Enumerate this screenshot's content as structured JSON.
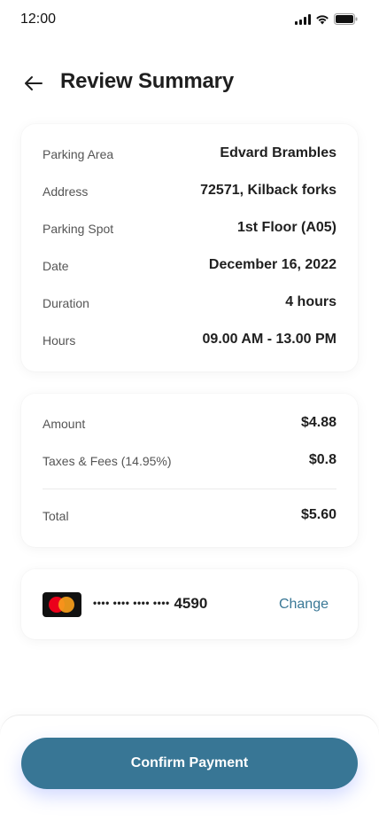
{
  "status_bar": {
    "time": "12:00"
  },
  "header": {
    "title": "Review Summary",
    "back_icon": "arrow-left-icon"
  },
  "details": [
    {
      "label": "Parking Area",
      "value": "Edvard Brambles"
    },
    {
      "label": "Address",
      "value": "72571, Kilback forks"
    },
    {
      "label": "Parking Spot",
      "value": "1st Floor (A05)"
    },
    {
      "label": "Date",
      "value": "December 16, 2022"
    },
    {
      "label": "Duration",
      "value": "4 hours"
    },
    {
      "label": "Hours",
      "value": "09.00 AM - 13.00 PM"
    }
  ],
  "amount": {
    "amount_label": "Amount",
    "amount_value": "$4.88",
    "taxes_label": "Taxes & Fees (14.95%)",
    "taxes_value": "$0.8",
    "total_label": "Total",
    "total_value": "$5.60"
  },
  "payment": {
    "card_icon": "mastercard-icon",
    "masked_number": "•••• •••• •••• ••••",
    "last_digits": "4590",
    "change_label": "Change"
  },
  "confirm_label": "Confirm Payment",
  "colors": {
    "accent": "#387695",
    "link": "#3a7896",
    "text": "#1f1f1f",
    "muted": "#555555"
  }
}
